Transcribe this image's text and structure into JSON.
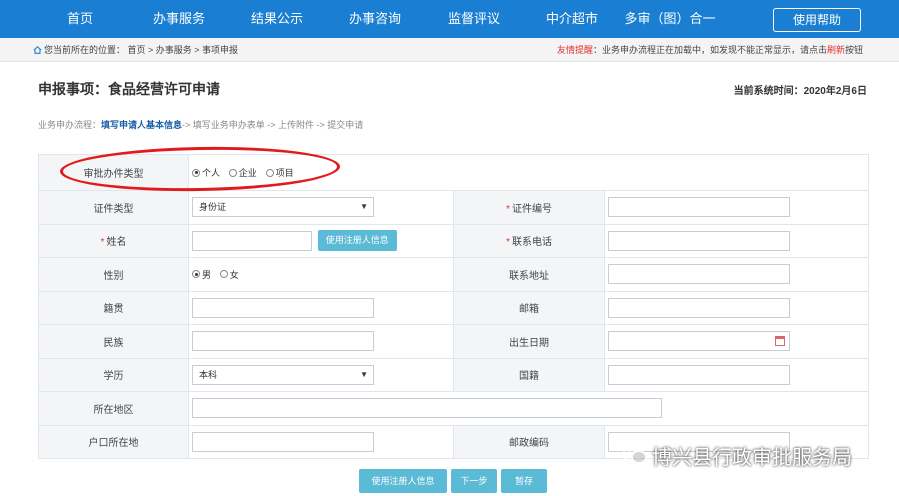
{
  "nav": {
    "items": [
      "首页",
      "办事服务",
      "结果公示",
      "办事咨询",
      "监督评议",
      "中介超市",
      "多审（图）合一"
    ],
    "help_label": "使用帮助"
  },
  "breadcrumb": {
    "text": "您当前所在的位置： 首页 > 办事服务 > 事项申报",
    "notice_prefix": "友情提醒",
    "notice_body": "：业务申办流程正在加载中，如发现不能正常显示，请点击",
    "notice_link": "刷新",
    "notice_suffix": "按钮"
  },
  "page": {
    "title": "申报事项：食品经营许可申请",
    "systime": "当前系统时间：2020年2月6日"
  },
  "steps": {
    "prefix": "业务申办流程：",
    "active": "填写申请人基本信息",
    "rest": "-> 填写业务申办表单 -> 上传附件 -> 提交申请"
  },
  "form": {
    "approval_type_label": "审批办件类型",
    "approval_options": [
      "个人",
      "企业",
      "项目"
    ],
    "cert_type_label": "证件类型",
    "cert_type_value": "身份证",
    "cert_no_label": "证件编号",
    "name_label": "姓名",
    "use_registered_label": "使用注册人信息",
    "phone_label": "联系电话",
    "gender_label": "性别",
    "gender_options": [
      "男",
      "女"
    ],
    "address_label": "联系地址",
    "native_label": "籍贯",
    "email_label": "邮箱",
    "ethnic_label": "民族",
    "birth_label": "出生日期",
    "edu_label": "学历",
    "edu_value": "本科",
    "nationality_label": "国籍",
    "region_label": "所在地区",
    "hukou_label": "户口所在地",
    "postcode_label": "邮政编码",
    "required_mark": "*"
  },
  "buttons": {
    "use_registered": "使用注册人信息",
    "next": "下一步",
    "save": "暂存"
  },
  "watermark": {
    "text": "博兴县行政审批服务局"
  },
  "colors": {
    "nav_bg": "#1a7fd2",
    "button": "#5bbad5",
    "highlight": "#e11b1b",
    "required": "#e0302f"
  }
}
